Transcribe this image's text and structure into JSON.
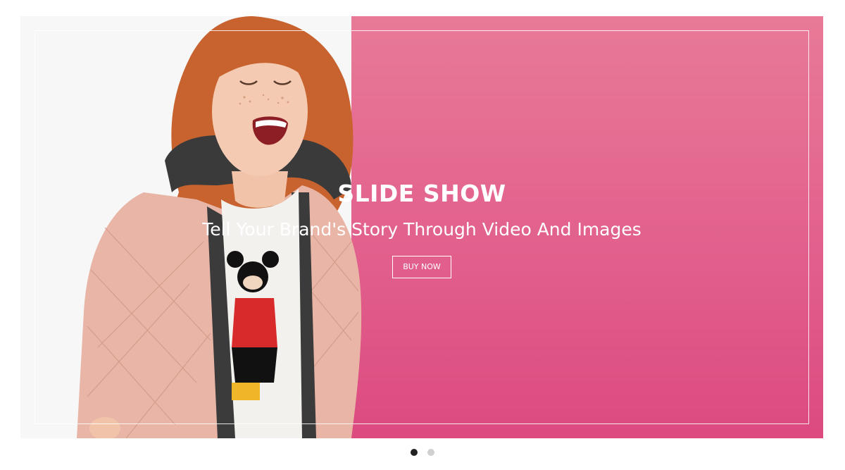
{
  "slideshow": {
    "title": "SLIDE SHOW",
    "subtitle": "Tell Your Brand's Story Through Video And Images",
    "button_label": "BUY NOW",
    "active_slide": 1,
    "slide_count": 2,
    "colors": {
      "background_top": "#e87a97",
      "background_bottom": "#dc4a80",
      "text": "#ffffff",
      "dot_active": "#222222",
      "dot_inactive": "#d0d0d0"
    },
    "image": "girl-laughing-pink-jacket"
  }
}
